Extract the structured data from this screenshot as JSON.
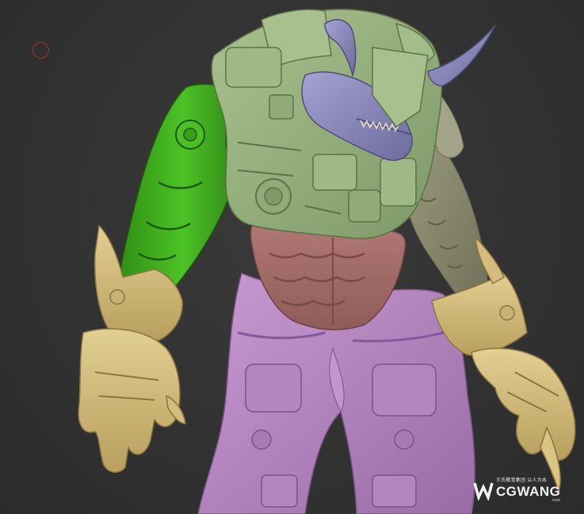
{
  "colors": {
    "background": "#333333",
    "brush_cursor": "#b22a2a",
    "polygroup_armor": "#98b27e",
    "polygroup_left_arm": "#3faa1e",
    "polygroup_gauntlets": "#d8c27e",
    "polygroup_torso": "#a6706c",
    "polygroup_legs": "#b98ac2",
    "polygroup_head": "#8d8bbd",
    "polygroup_right_arm": "#8e8f72"
  },
  "icons": {
    "brush_cursor": "brush-cursor-icon",
    "watermark_logo": "cgwang-logo-icon"
  },
  "watermark": {
    "tagline": "王氏教育集团 以人为本",
    "brand": "CGWANG",
    "domain": ".com"
  }
}
